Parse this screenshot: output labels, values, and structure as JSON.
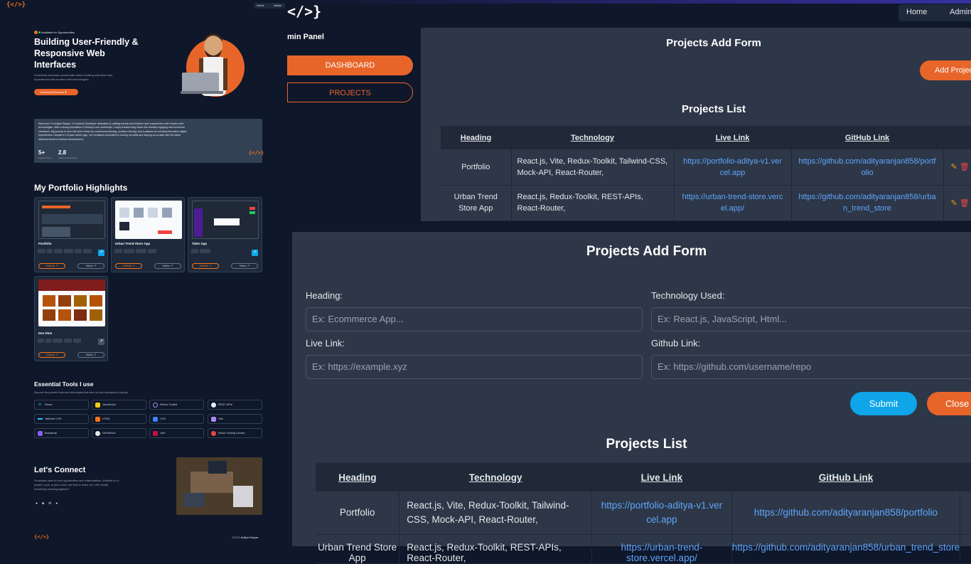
{
  "portfolio": {
    "nav": {
      "home": "Home",
      "admin": "Admin"
    },
    "logo": "{</>}",
    "badge": "Available for Opportunities",
    "hero_title_1": "Building User-Friendly &",
    "hero_title_2": "Responsive Web",
    "hero_title_3": "Interfaces",
    "hero_desc_1": "A frontend developer passionate about creating seamless user",
    "hero_desc_2": "experiences with modern web technologies.",
    "download_btn": "Download Resume",
    "about_1": "Welcome! I'm Aditya Ranjan, a Frontend Developer dedicated to crafting smooth and intuitive user experiences with modern web",
    "about_2": "technologies. With a strong foundation in React.js and JavaScript, I enjoy transforming ideas into visually engaging and functional",
    "about_3": "interfaces. My journey in tech has been driven by continuous learning, problem-solving, and a passion for building interactive digital",
    "about_4": "experiences. Despite a 1.5-year career gap, I've remained committed to honing my skills and staying up-to-date with the latest",
    "about_5": "advancements in frontend development.",
    "stat1_value": "5+",
    "stat1_label": "Projects Done",
    "stat2_value": "2.8",
    "stat2_label": "Years of experience",
    "highlights_title": "My Portfolio Highlights",
    "projects": [
      {
        "name": "Portfolio",
        "github": "GitHub",
        "video": "Video"
      },
      {
        "name": "Urban Trend Store App",
        "github": "GitHub",
        "video": "Video"
      },
      {
        "name": "ToDo App",
        "github": "GitHub",
        "video": "Video"
      },
      {
        "name": "Dev Dine",
        "github": "GitHub",
        "video": "Video"
      }
    ],
    "tools_title": "Essential Tools I use",
    "tools_sub": "Discover the powerful tools and technologies that drive my web development journey.",
    "tools": [
      "React",
      "JavaScript",
      "Redux Toolkit",
      "REST APIs",
      "Tailwind CSS",
      "HTML",
      "CSS",
      "Vite",
      "Bootstrap",
      "Git/GitHub",
      "Jest",
      "React Testing Library"
    ],
    "connect_title": "Let's Connect",
    "connect_1": "I'm always open to new opportunities and collaborations. Whether it's a",
    "connect_2": "project, a job, or just a chat, feel free to reach out. Let's create",
    "connect_3": "something amazing together!",
    "footer_copy": "©2025",
    "footer_name": "Aditya Ranjan"
  },
  "admin": {
    "logo": "</>}",
    "nav": {
      "home": "Home",
      "admin": "Admin"
    },
    "panel_title": "min Panel",
    "dashboard": "DASHBOARD",
    "projects": "PROJECTS",
    "top_form_title": "Projects Add Form",
    "add_project_btn": "Add Project",
    "top_list_title": "Projects List",
    "columns": [
      "Heading",
      "Technology",
      "Live Link",
      "GitHub Link"
    ],
    "rows": [
      {
        "heading": "Portfolio",
        "tech": "React.js, Vite, Redux-Toolkit, Tailwind-CSS, Mock-API, React-Router,",
        "live": "https://portfolio-aditya-v1.vercel.app",
        "github": "https://github.com/adityaranjan858/portfolio"
      },
      {
        "heading": "Urban Trend Store App",
        "tech": "React.js, Redux-Toolkit, REST-APIs, React-Router,",
        "live": "https://urban-trend-store.vercel.app/",
        "github": "https://github.com/adityaranjan858/urban_trend_store"
      }
    ]
  },
  "form": {
    "title": "Projects Add Form",
    "heading_label": "Heading:",
    "heading_placeholder": "Ex: Ecommerce App...",
    "tech_label": "Technology Used:",
    "tech_placeholder": "Ex: React.js, JavaScript, Html...",
    "live_label": "Live Link:",
    "live_placeholder": "Ex: https://example.xyz",
    "github_label": "Github Link:",
    "github_placeholder": "Ex: https://github.com/username/repo",
    "submit": "Submit",
    "close": "Close",
    "list_title": "Projects List"
  },
  "colors": {
    "accent": "#e8652a",
    "submit": "#0ea5e9",
    "panel": "#2d3748",
    "bg": "#0f172a",
    "link": "#60a5fa"
  }
}
